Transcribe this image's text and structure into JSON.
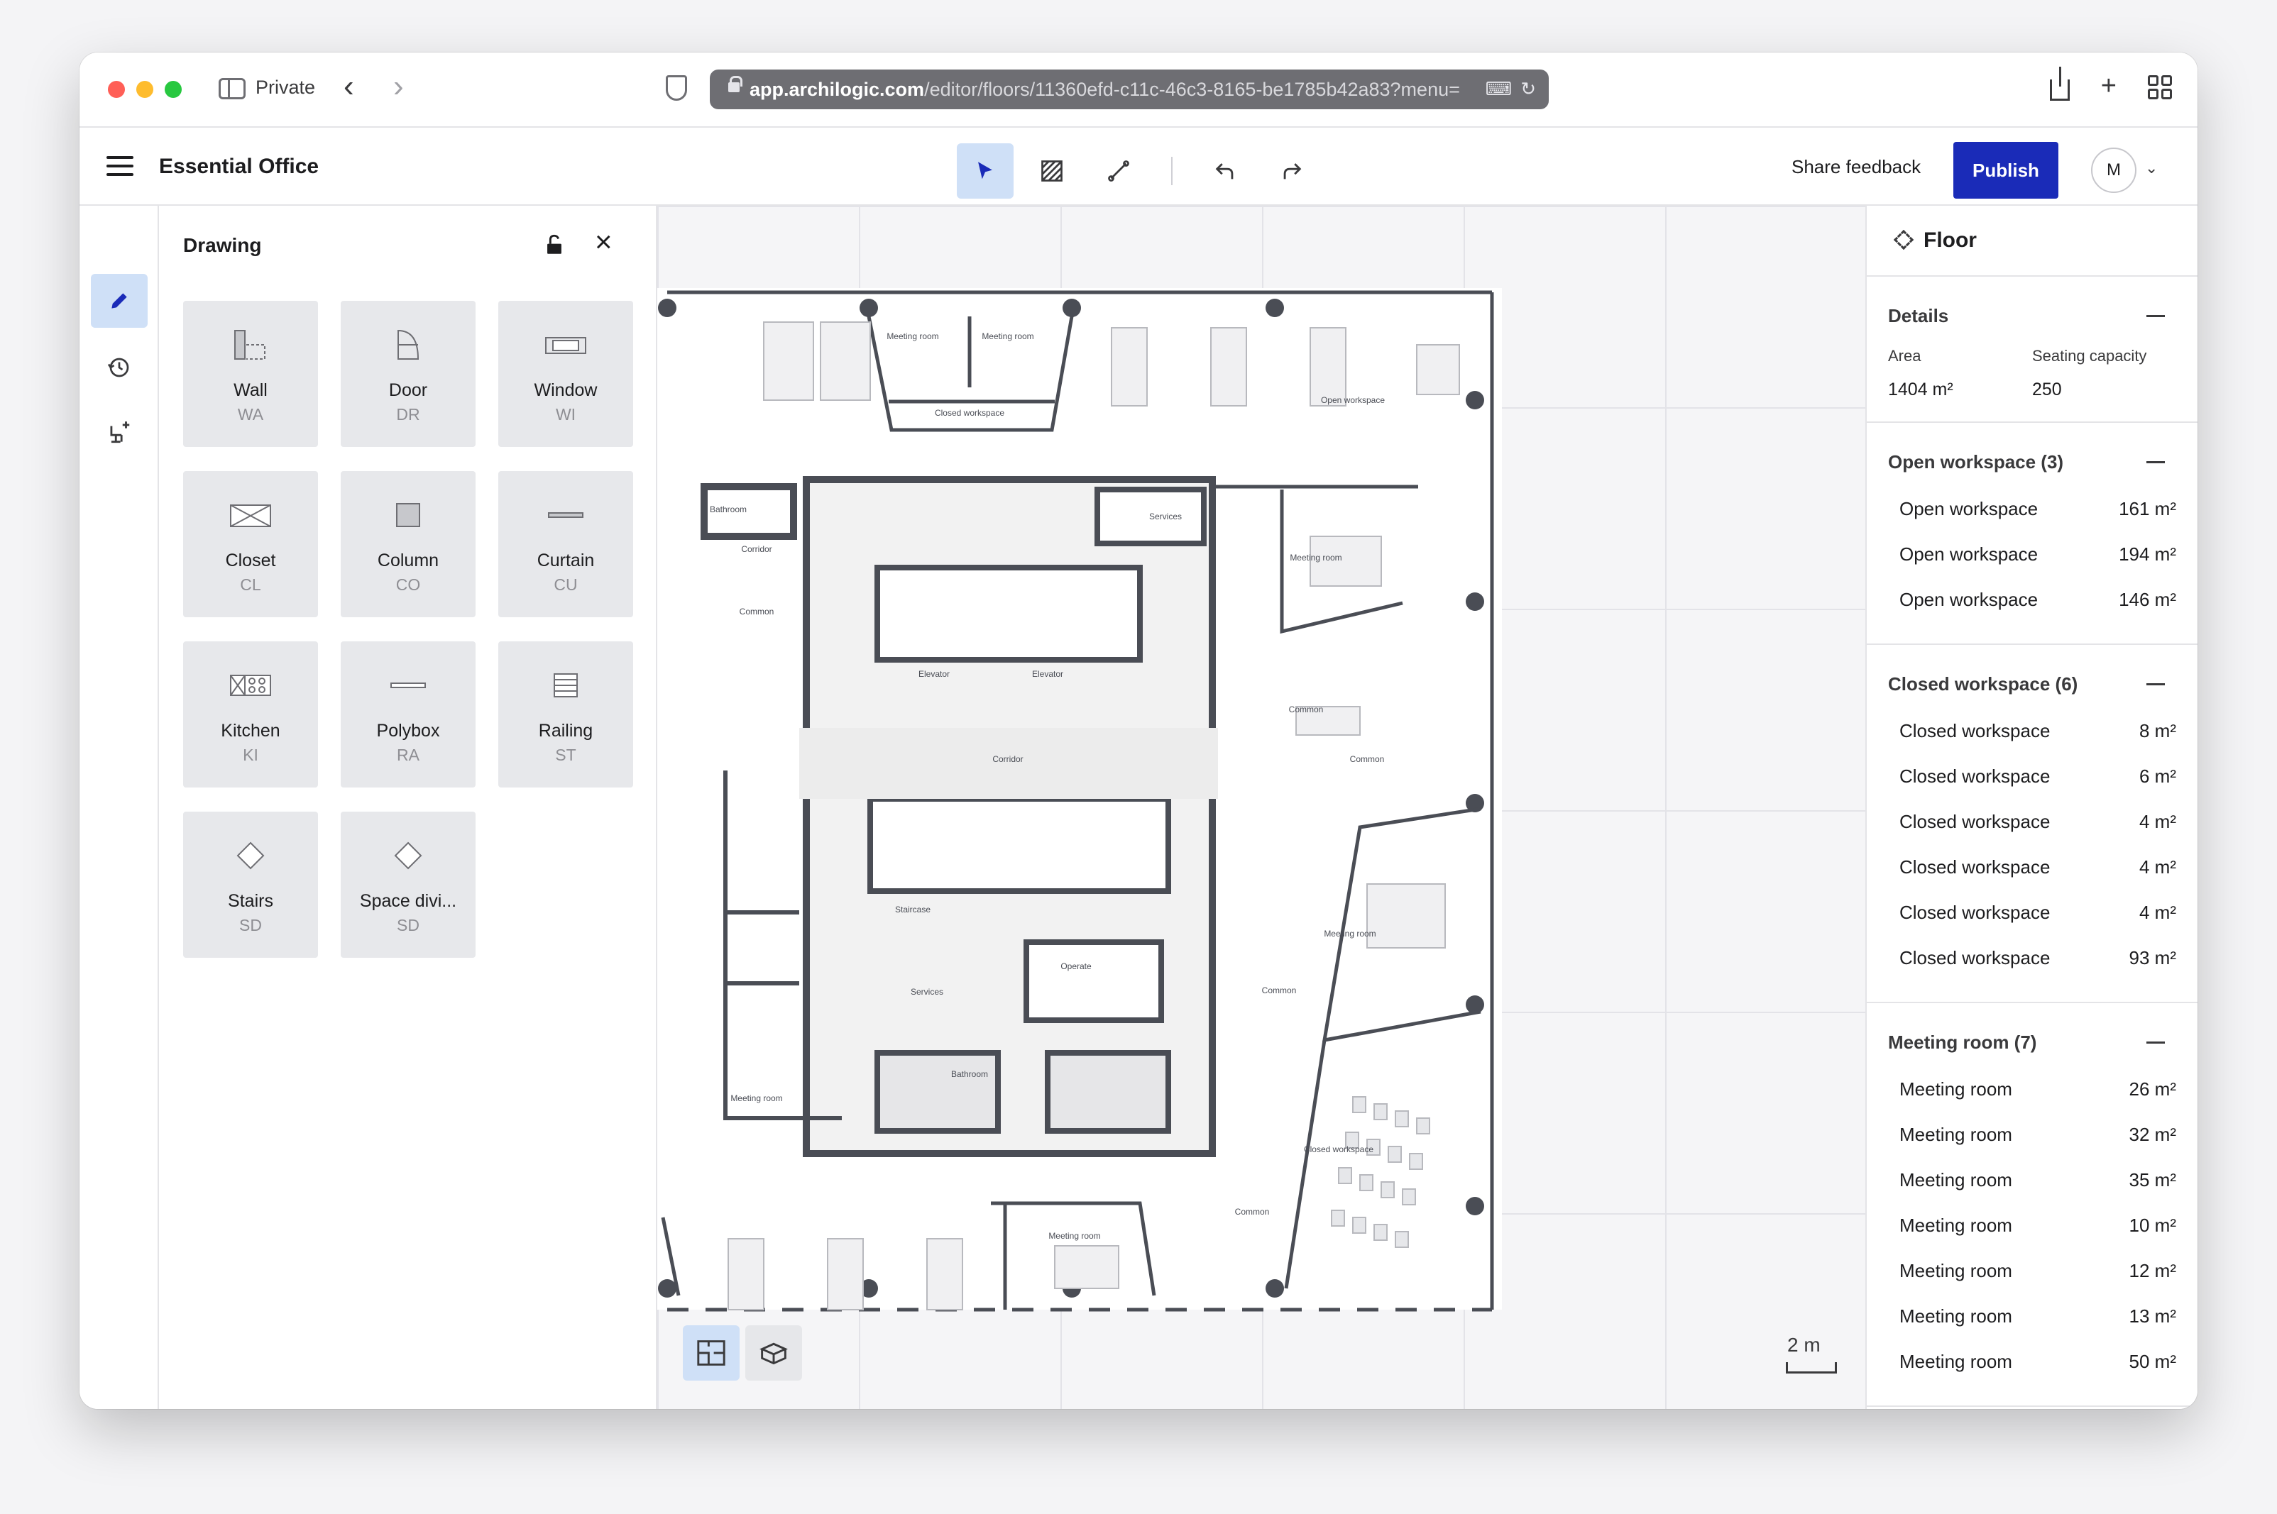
{
  "browser": {
    "private_label": "Private",
    "url_host": "app.archilogic.com",
    "url_path": "/editor/floors/11360efd-c11c-46c3-8165-be1785b42a83?menu=",
    "traffic_colors": [
      "#ff5f57",
      "#febc2e",
      "#28c840"
    ]
  },
  "header": {
    "title": "Essential Office",
    "share_feedback": "Share feedback",
    "publish": "Publish",
    "avatar_initial": "M",
    "accent": "#1a2bb8"
  },
  "drawing_panel": {
    "title": "Drawing",
    "tiles": [
      {
        "name": "Wall",
        "key": "WA",
        "icon": "wall-icon"
      },
      {
        "name": "Door",
        "key": "DR",
        "icon": "door-icon"
      },
      {
        "name": "Window",
        "key": "WI",
        "icon": "window-icon"
      },
      {
        "name": "Closet",
        "key": "CL",
        "icon": "closet-icon"
      },
      {
        "name": "Column",
        "key": "CO",
        "icon": "column-icon"
      },
      {
        "name": "Curtain",
        "key": "CU",
        "icon": "curtain-icon"
      },
      {
        "name": "Kitchen",
        "key": "KI",
        "icon": "kitchen-icon"
      },
      {
        "name": "Polybox",
        "key": "RA",
        "icon": "polybox-icon"
      },
      {
        "name": "Railing",
        "key": "ST",
        "icon": "railing-icon"
      },
      {
        "name": "Stairs",
        "key": "SD",
        "icon": "stairs-icon"
      },
      {
        "name": "Space divi...",
        "key": "SD",
        "icon": "space-divider-icon"
      }
    ]
  },
  "canvas": {
    "scale_label": "2 m",
    "labels": {
      "meeting_room": "Meeting room",
      "closed_workspace": "Closed workspace",
      "open_workspace": "Open workspace",
      "bathroom": "Bathroom",
      "corridor": "Corridor",
      "common": "Common",
      "elevator": "Elevator",
      "services": "Services",
      "staircase": "Staircase",
      "operate": "Operate"
    }
  },
  "right_panel": {
    "title": "Floor",
    "details": {
      "title": "Details",
      "area_label": "Area",
      "area_value": "1404 m²",
      "seating_label": "Seating capacity",
      "seating_value": "250"
    },
    "open_workspace": {
      "title": "Open workspace (3)",
      "rows": [
        {
          "name": "Open workspace",
          "area": "161 m²"
        },
        {
          "name": "Open workspace",
          "area": "194 m²"
        },
        {
          "name": "Open workspace",
          "area": "146 m²"
        }
      ]
    },
    "closed_workspace": {
      "title": "Closed workspace (6)",
      "rows": [
        {
          "name": "Closed workspace",
          "area": "8 m²"
        },
        {
          "name": "Closed workspace",
          "area": "6 m²"
        },
        {
          "name": "Closed workspace",
          "area": "4 m²"
        },
        {
          "name": "Closed workspace",
          "area": "4 m²"
        },
        {
          "name": "Closed workspace",
          "area": "4 m²"
        },
        {
          "name": "Closed workspace",
          "area": "93 m²"
        }
      ]
    },
    "meeting_room": {
      "title": "Meeting room (7)",
      "rows": [
        {
          "name": "Meeting room",
          "area": "26 m²"
        },
        {
          "name": "Meeting room",
          "area": "32 m²"
        },
        {
          "name": "Meeting room",
          "area": "35 m²"
        },
        {
          "name": "Meeting room",
          "area": "10 m²"
        },
        {
          "name": "Meeting room",
          "area": "12 m²"
        },
        {
          "name": "Meeting room",
          "area": "13 m²"
        },
        {
          "name": "Meeting room",
          "area": "50 m²"
        }
      ]
    }
  }
}
